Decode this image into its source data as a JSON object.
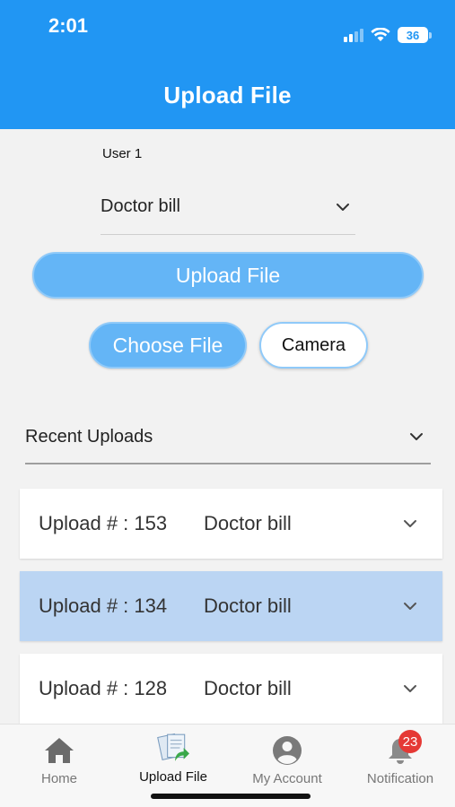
{
  "status_bar": {
    "time": "2:01",
    "battery": "36"
  },
  "header": {
    "title": "Upload File"
  },
  "form": {
    "user_label": "User 1",
    "document_type": "Doctor bill",
    "upload_label": "Upload File",
    "choose_label": "Choose File",
    "camera_label": "Camera"
  },
  "recent": {
    "label": "Recent Uploads",
    "items": [
      {
        "number": "Upload # : 153",
        "type": "Doctor bill"
      },
      {
        "number": "Upload # : 134",
        "type": "Doctor bill"
      },
      {
        "number": "Upload # : 128",
        "type": "Doctor bill"
      }
    ]
  },
  "nav": {
    "items": [
      {
        "label": "Home",
        "icon": "home-icon"
      },
      {
        "label": "Upload File",
        "icon": "upload-documents-icon"
      },
      {
        "label": "My Account",
        "icon": "account-icon"
      },
      {
        "label": "Notification",
        "icon": "bell-icon",
        "badge": "23"
      }
    ]
  },
  "colors": {
    "primary": "#2196f3",
    "button": "#64b5f6",
    "selected_row": "#bbd5f3",
    "badge": "#e53935"
  }
}
